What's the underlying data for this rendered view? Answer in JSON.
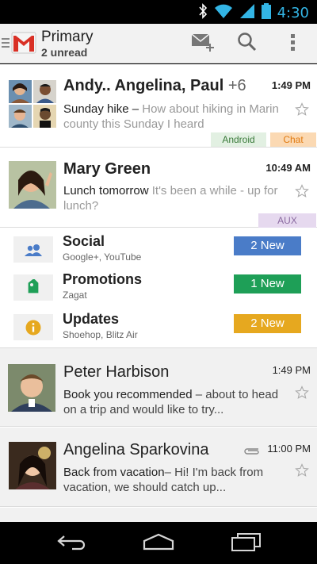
{
  "status_bar": {
    "time": "4:30",
    "icons": [
      "bluetooth-icon",
      "wifi-icon",
      "signal-icon",
      "battery-icon"
    ]
  },
  "app_bar": {
    "title": "Primary",
    "subtitle": "2 unread",
    "actions": [
      "compose-icon",
      "search-icon",
      "overflow-menu-icon"
    ]
  },
  "threads": [
    {
      "sender": "Andy.. Angelina, Paul",
      "count": "+6",
      "time": "1:49 PM",
      "subject": "Sunday hike",
      "separator": " – ",
      "snippet": "How about hiking in Marin county this Sunday I heard",
      "labels": [
        {
          "text": "Android",
          "bg": "#e2f0e2",
          "color": "#3a7a3a"
        },
        {
          "text": "Chat",
          "bg": "#fbd9b3",
          "color": "#e07a10"
        }
      ],
      "unread": true
    },
    {
      "sender": "Mary Green",
      "time": "10:49 AM",
      "subject": "Lunch tomorrow",
      "separator": " ",
      "snippet": "It's been a while - up for lunch?",
      "labels": [
        {
          "text": "AUX",
          "bg": "#e6d9ef",
          "color": "#8a6aa0"
        }
      ],
      "unread": true
    },
    {
      "sender": "Peter Harbison",
      "time": "1:49 PM",
      "subject": "Book you recommended",
      "separator": " – ",
      "snippet": "about to head on a trip and would like to try...",
      "unread": false
    },
    {
      "sender": "Angelina Sparkovina",
      "time": "11:00 PM",
      "subject": "Back from vacation",
      "separator": "– ",
      "snippet": "Hi! I'm back from vacation, we should catch up...",
      "has_attachment": true,
      "unread": false
    }
  ],
  "categories": [
    {
      "title": "Social",
      "sub": "Google+, YouTube",
      "badge": "2 New",
      "badge_color": "#4a7cc8",
      "icon": "social-people-icon"
    },
    {
      "title": "Promotions",
      "sub": "Zagat",
      "badge": "1 New",
      "badge_color": "#1e9f57",
      "icon": "promotions-tag-icon"
    },
    {
      "title": "Updates",
      "sub": "Shoehop, Blitz Air",
      "badge": "2 New",
      "badge_color": "#e6a81f",
      "icon": "updates-info-icon"
    }
  ],
  "nav_bar": {
    "buttons": [
      "back-icon",
      "home-icon",
      "recent-apps-icon"
    ]
  },
  "colors": {
    "accent_blue": "#33b5e5",
    "gmail_red": "#d93025"
  }
}
